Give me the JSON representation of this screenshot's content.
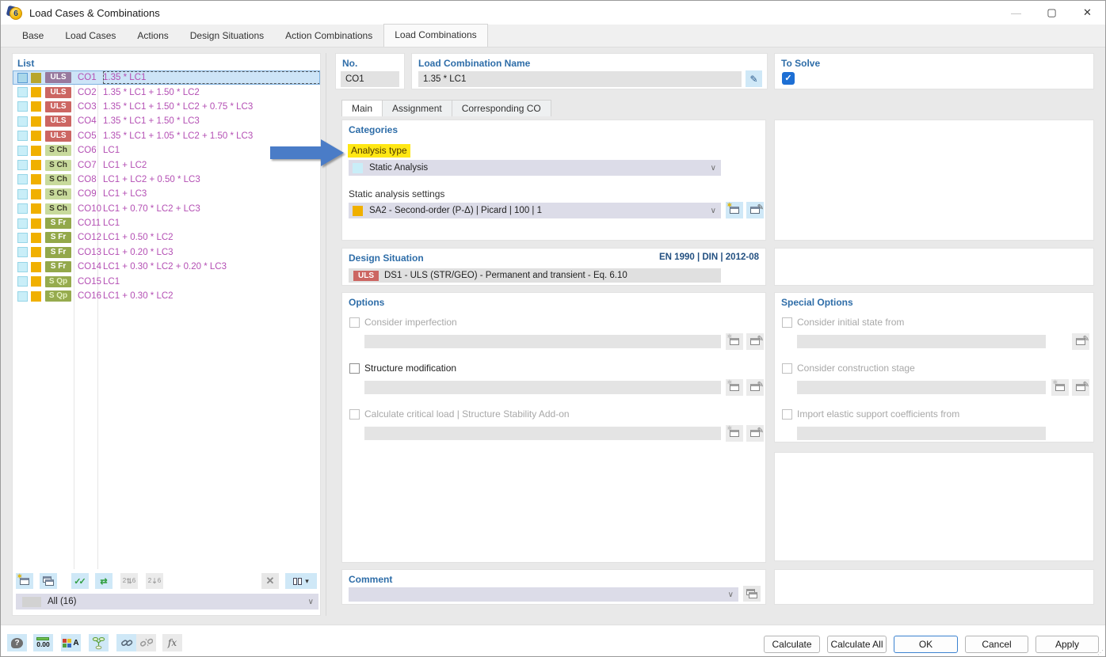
{
  "window": {
    "title": "Load Cases & Combinations"
  },
  "window_controls": {
    "minimize": "—",
    "maximize": "▢",
    "close": "✕"
  },
  "main_tabs": {
    "items": [
      {
        "label": "Base",
        "active": false
      },
      {
        "label": "Load Cases",
        "active": false
      },
      {
        "label": "Actions",
        "active": false
      },
      {
        "label": "Design Situations",
        "active": false
      },
      {
        "label": "Action Combinations",
        "active": false
      },
      {
        "label": "Load Combinations",
        "active": true
      }
    ]
  },
  "list_panel": {
    "title": "List",
    "rows": [
      {
        "id": "CO1",
        "badge": "ULS",
        "badge_type": "uls",
        "formula": "1.35 * LC1",
        "selected": true
      },
      {
        "id": "CO2",
        "badge": "ULS",
        "badge_type": "uls",
        "formula": "1.35 * LC1 + 1.50 * LC2",
        "selected": false
      },
      {
        "id": "CO3",
        "badge": "ULS",
        "badge_type": "uls",
        "formula": "1.35 * LC1 + 1.50 * LC2 + 0.75 * LC3",
        "selected": false
      },
      {
        "id": "CO4",
        "badge": "ULS",
        "badge_type": "uls",
        "formula": "1.35 * LC1 + 1.50 * LC3",
        "selected": false
      },
      {
        "id": "CO5",
        "badge": "ULS",
        "badge_type": "uls",
        "formula": "1.35 * LC1 + 1.05 * LC2 + 1.50 * LC3",
        "selected": false
      },
      {
        "id": "CO6",
        "badge": "S Ch",
        "badge_type": "sch",
        "formula": "LC1",
        "selected": false
      },
      {
        "id": "CO7",
        "badge": "S Ch",
        "badge_type": "sch",
        "formula": "LC1 + LC2",
        "selected": false
      },
      {
        "id": "CO8",
        "badge": "S Ch",
        "badge_type": "sch",
        "formula": "LC1 + LC2 + 0.50 * LC3",
        "selected": false
      },
      {
        "id": "CO9",
        "badge": "S Ch",
        "badge_type": "sch",
        "formula": "LC1 + LC3",
        "selected": false
      },
      {
        "id": "CO10",
        "badge": "S Ch",
        "badge_type": "sch",
        "formula": "LC1 + 0.70 * LC2 + LC3",
        "selected": false
      },
      {
        "id": "CO11",
        "badge": "S Fr",
        "badge_type": "sfr",
        "formula": "LC1",
        "selected": false
      },
      {
        "id": "CO12",
        "badge": "S Fr",
        "badge_type": "sfr",
        "formula": "LC1 + 0.50 * LC2",
        "selected": false
      },
      {
        "id": "CO13",
        "badge": "S Fr",
        "badge_type": "sfr",
        "formula": "LC1 + 0.20 * LC3",
        "selected": false
      },
      {
        "id": "CO14",
        "badge": "S Fr",
        "badge_type": "sfr",
        "formula": "LC1 + 0.30 * LC2 + 0.20 * LC3",
        "selected": false
      },
      {
        "id": "CO15",
        "badge": "S Qp",
        "badge_type": "sqp",
        "formula": "LC1",
        "selected": false
      },
      {
        "id": "CO16",
        "badge": "S Qp",
        "badge_type": "sqp",
        "formula": "LC1 + 0.30 * LC2",
        "selected": false
      }
    ],
    "filter_value": "All (16)"
  },
  "header_fields": {
    "no_label": "No.",
    "no_value": "CO1",
    "name_label": "Load Combination Name",
    "name_value": "1.35 * LC1",
    "to_solve_label": "To Solve",
    "to_solve_checked": true
  },
  "sub_tabs": {
    "items": [
      {
        "label": "Main",
        "active": true
      },
      {
        "label": "Assignment",
        "active": false
      },
      {
        "label": "Corresponding CO",
        "active": false
      }
    ]
  },
  "categories": {
    "title": "Categories",
    "analysis_type_label": "Analysis type",
    "analysis_type_value": "Static Analysis",
    "settings_label": "Static analysis settings",
    "settings_value": "SA2 - Second-order (P-Δ) | Picard | 100 | 1"
  },
  "design_situation": {
    "title": "Design Situation",
    "standard": "EN 1990 | DIN | 2012-08",
    "badge": "ULS",
    "value": "DS1 - ULS (STR/GEO) - Permanent and transient - Eq. 6.10"
  },
  "options": {
    "title": "Options",
    "items": [
      {
        "label": "Consider imperfection",
        "enabled": false,
        "checked": false
      },
      {
        "label": "Structure modification",
        "enabled": true,
        "checked": false
      },
      {
        "label": "Calculate critical load | Structure Stability Add-on",
        "enabled": false,
        "checked": false
      }
    ]
  },
  "special_options": {
    "title": "Special Options",
    "items": [
      {
        "label": "Consider initial state from",
        "enabled": false,
        "checked": false
      },
      {
        "label": "Consider construction stage",
        "enabled": false,
        "checked": false
      },
      {
        "label": "Import elastic support coefficients from",
        "enabled": false,
        "checked": false
      }
    ]
  },
  "comment": {
    "title": "Comment",
    "value": ""
  },
  "footer": {
    "buttons": [
      {
        "label": "Calculate",
        "default": false
      },
      {
        "label": "Calculate All",
        "default": false
      },
      {
        "label": "OK",
        "default": true
      },
      {
        "label": "Cancel",
        "default": false
      },
      {
        "label": "Apply",
        "default": false
      }
    ]
  },
  "icons": {
    "help": "?",
    "units": "0.00",
    "formula": "fx",
    "new_star": "✶",
    "edit_pencil": "✎",
    "delete_x": "✕",
    "check": "✓",
    "invert_arrows": "⇄",
    "chevron_down": "∨",
    "dropdown_triangle": "▾",
    "renumber_a": "2",
    "renumber_b": "6",
    "grip": "⋰"
  },
  "colors": {
    "accent_blue": "#2e6da8",
    "selection_bg": "#cde4f7",
    "magenta_text": "#b44fb4",
    "uls_badge": "#cc6662",
    "uls_badge_selected": "#97799e",
    "sch_badge": "#c8da9c",
    "sfr_badge": "#93a84a",
    "sqp_badge": "#96ab4e",
    "amber_swatch": "#f0b000",
    "cyan_swatch": "#c9eef8",
    "highlight_yellow": "#ffe714",
    "arrow_blue": "#4a7cc7",
    "field_gray": "#e2e2e2",
    "dropdown_lavender": "#dcdce8",
    "button_blue_bg": "#cfe8f7",
    "checkbox_checked": "#1d6fd4"
  }
}
